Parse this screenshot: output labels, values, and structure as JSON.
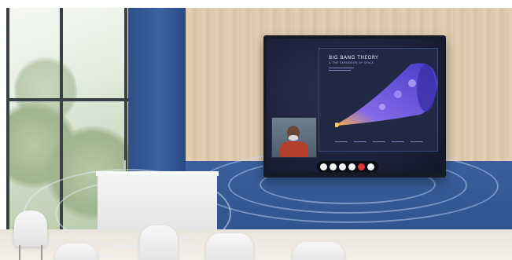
{
  "screen": {
    "slide_title": "BIG BANG THEORY",
    "slide_subtitle": "& THE EXPANSION OF SPACE"
  },
  "colors": {
    "wall_blue": "#2f548e",
    "wood": "#dcc7ab",
    "end_call": "#e0303a",
    "cone": "#6a5be0"
  },
  "icons": [
    "camera-icon",
    "user-icon",
    "settings-icon",
    "info-icon",
    "end-call-icon",
    "more-icon"
  ]
}
